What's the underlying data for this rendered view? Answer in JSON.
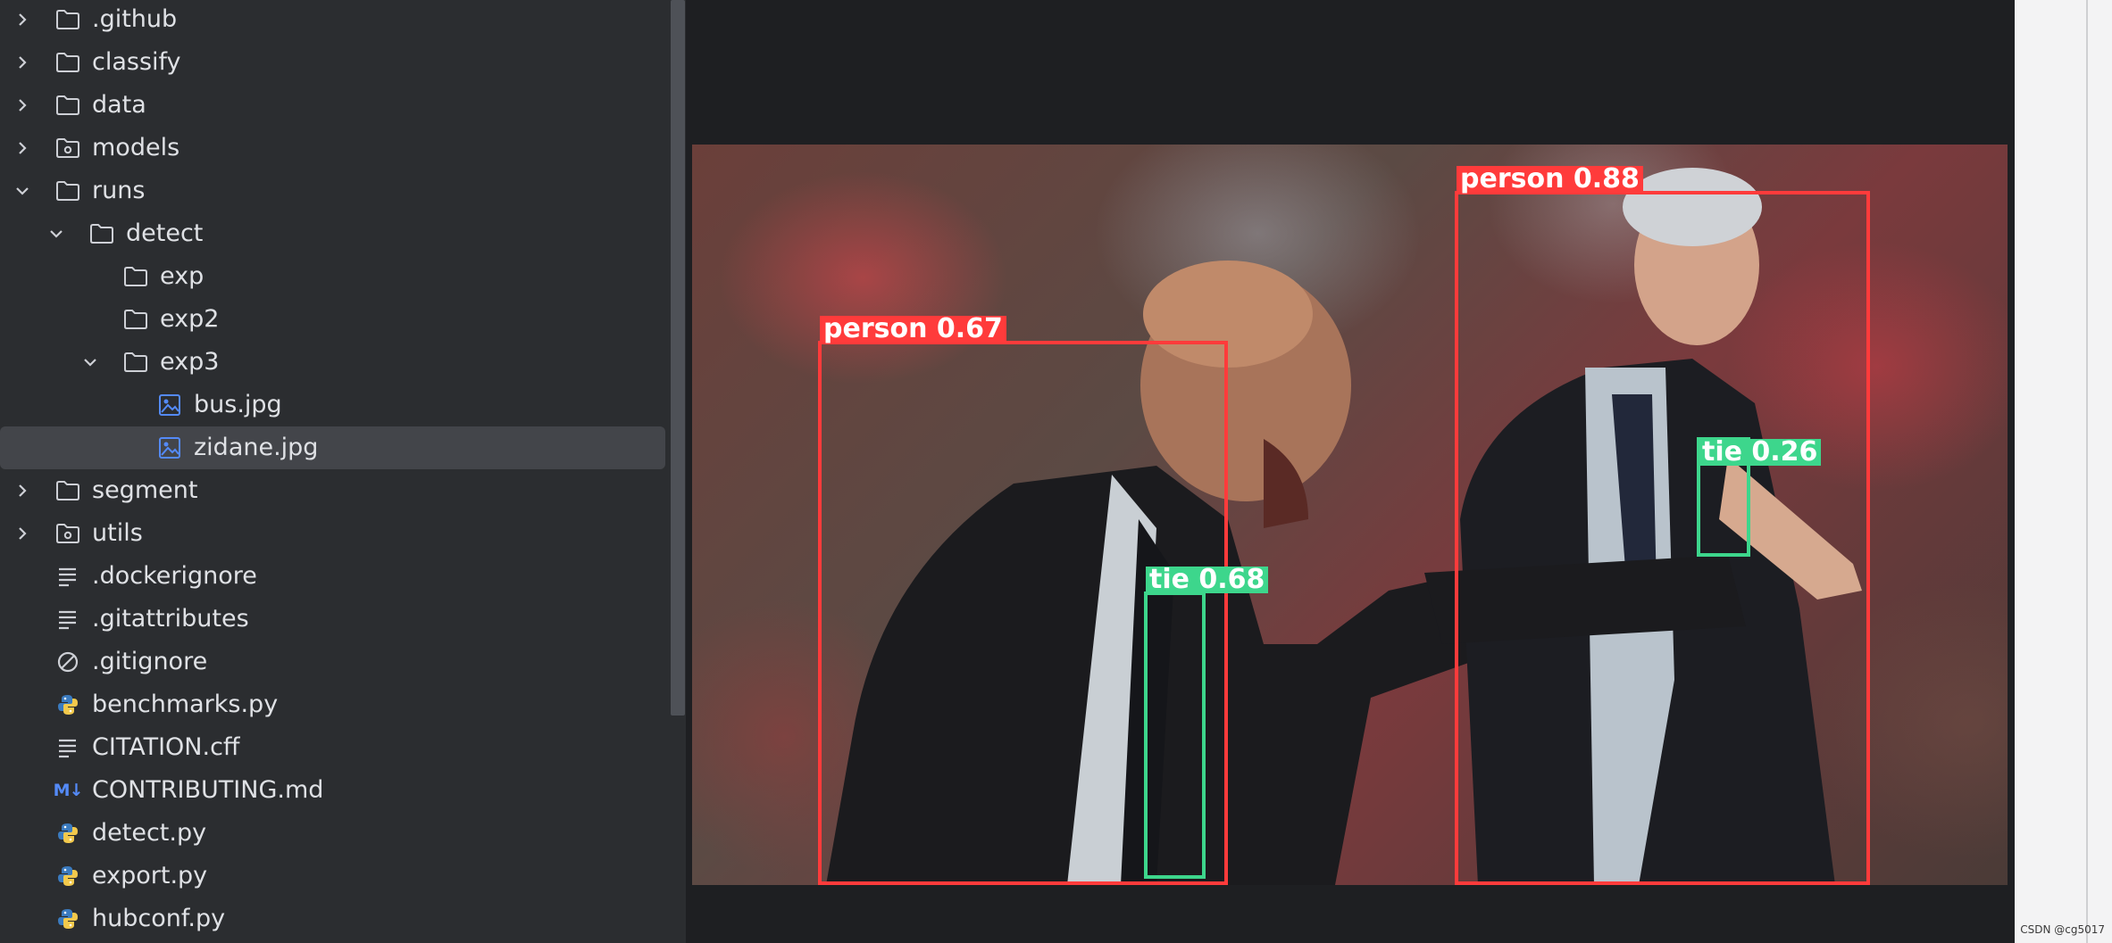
{
  "project_tree": {
    "items": [
      {
        "label": ".github",
        "kind": "folder",
        "indent": 0,
        "chevron": "right"
      },
      {
        "label": "classify",
        "kind": "folder",
        "indent": 0,
        "chevron": "right"
      },
      {
        "label": "data",
        "kind": "folder",
        "indent": 0,
        "chevron": "right"
      },
      {
        "label": "models",
        "kind": "package-folder",
        "indent": 0,
        "chevron": "right"
      },
      {
        "label": "runs",
        "kind": "folder",
        "indent": 0,
        "chevron": "down"
      },
      {
        "label": "detect",
        "kind": "folder",
        "indent": 1,
        "chevron": "down"
      },
      {
        "label": "exp",
        "kind": "folder",
        "indent": 2,
        "chevron": "none"
      },
      {
        "label": "exp2",
        "kind": "folder",
        "indent": 2,
        "chevron": "none"
      },
      {
        "label": "exp3",
        "kind": "folder",
        "indent": 2,
        "chevron": "down"
      },
      {
        "label": "bus.jpg",
        "kind": "image",
        "indent": 3,
        "chevron": "none"
      },
      {
        "label": "zidane.jpg",
        "kind": "image",
        "indent": 3,
        "chevron": "none",
        "selected": true
      },
      {
        "label": "segment",
        "kind": "folder",
        "indent": 0,
        "chevron": "right"
      },
      {
        "label": "utils",
        "kind": "package-folder",
        "indent": 0,
        "chevron": "right"
      },
      {
        "label": ".dockerignore",
        "kind": "text",
        "indent": 0,
        "chevron": "none"
      },
      {
        "label": ".gitattributes",
        "kind": "text",
        "indent": 0,
        "chevron": "none"
      },
      {
        "label": ".gitignore",
        "kind": "ignore",
        "indent": 0,
        "chevron": "none"
      },
      {
        "label": "benchmarks.py",
        "kind": "python",
        "indent": 0,
        "chevron": "none"
      },
      {
        "label": "CITATION.cff",
        "kind": "text",
        "indent": 0,
        "chevron": "none"
      },
      {
        "label": "CONTRIBUTING.md",
        "kind": "markdown",
        "indent": 0,
        "chevron": "none"
      },
      {
        "label": "detect.py",
        "kind": "python",
        "indent": 0,
        "chevron": "none"
      },
      {
        "label": "export.py",
        "kind": "python",
        "indent": 0,
        "chevron": "none"
      },
      {
        "label": "hubconf.py",
        "kind": "python",
        "indent": 0,
        "chevron": "none"
      }
    ]
  },
  "image_viewer": {
    "detections": [
      {
        "label": "person 0.67",
        "class": "person",
        "color": "#ff3b3b"
      },
      {
        "label": "person 0.88",
        "class": "person",
        "color": "#ff3b3b"
      },
      {
        "label": "tie 0.68",
        "class": "tie",
        "color": "#3dd68c"
      },
      {
        "label": "tie 0.26",
        "class": "tie",
        "color": "#3dd68c"
      }
    ]
  },
  "watermark": "CSDN @cg5017",
  "colors": {
    "sidebar_bg": "#2b2d30",
    "viewer_bg": "#1e1f22",
    "selection_bg": "#43454a",
    "text": "#dfe1e5",
    "icon_gray": "#ced0d6",
    "image_icon_blue": "#548af7",
    "python_blue": "#3b7bbf",
    "python_yellow": "#f2c94c"
  }
}
